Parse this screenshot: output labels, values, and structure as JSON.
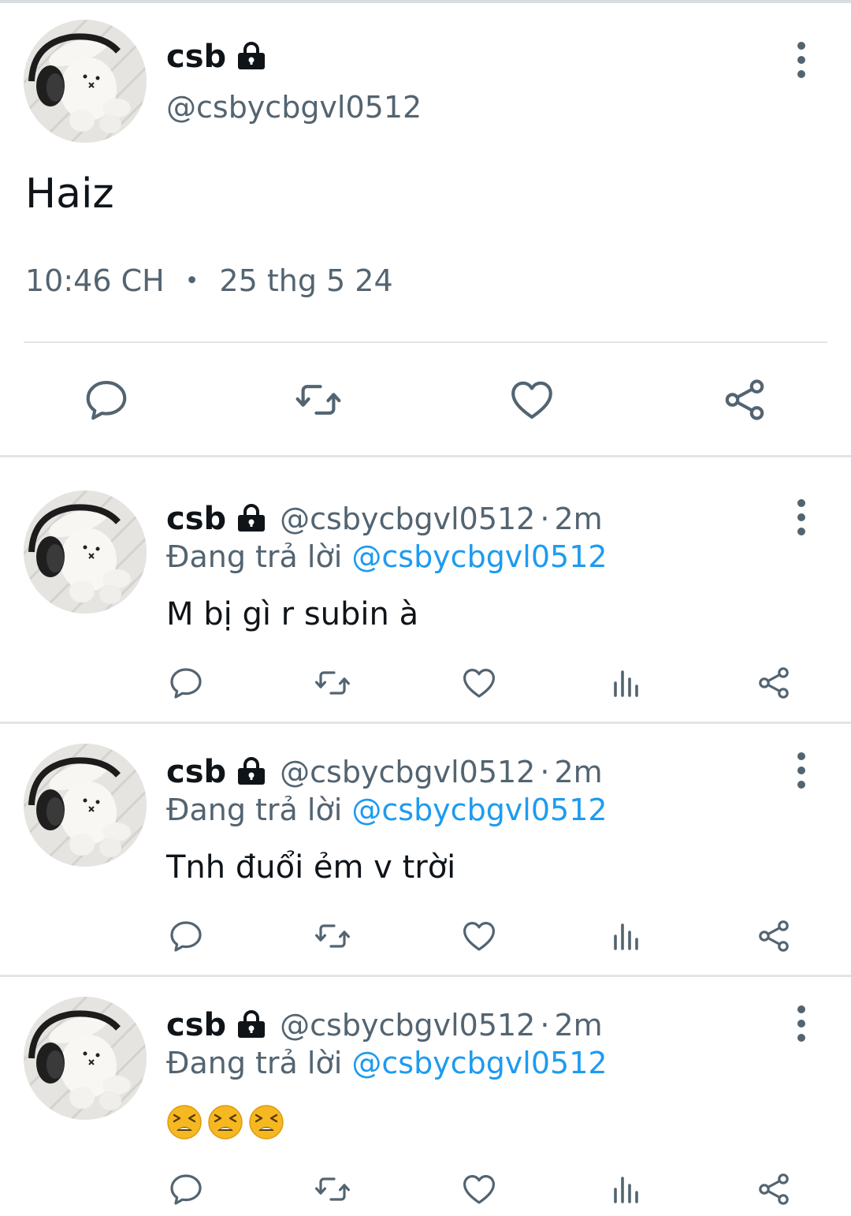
{
  "main_tweet": {
    "author_name": "csb",
    "author_handle": "@csbycbgvl0512",
    "text": "Haiz",
    "time": "10:46 CH",
    "date": "25 thg 5 24",
    "icons": {
      "lock": "lock-icon",
      "more": "more-vertical-icon",
      "reply": "comment-icon",
      "retweet": "retweet-icon",
      "like": "heart-icon",
      "share": "share-icon"
    }
  },
  "replies": [
    {
      "author_name": "csb",
      "author_handle": "@csbycbgvl0512",
      "separator": "·",
      "time": "2m",
      "replying_label": "Đang trả lời",
      "replying_to": "@csbycbgvl0512",
      "text": "M bị gì r subin à"
    },
    {
      "author_name": "csb",
      "author_handle": "@csbycbgvl0512",
      "separator": "·",
      "time": "2m",
      "replying_label": "Đang trả lời",
      "replying_to": "@csbycbgvl0512",
      "text": "Tnh đuổi ẻm v trời"
    },
    {
      "author_name": "csb",
      "author_handle": "@csbycbgvl0512",
      "separator": "·",
      "time": "2m",
      "replying_label": "Đang trả lời",
      "replying_to": "@csbycbgvl0512",
      "text": "",
      "emojis": [
        "tired-face",
        "tired-face",
        "tired-face"
      ]
    }
  ],
  "colors": {
    "text_primary": "#0f1419",
    "text_secondary": "#536471",
    "mention": "#1d9bf0",
    "divider": "#e1e5e8",
    "icon": "#536471"
  }
}
